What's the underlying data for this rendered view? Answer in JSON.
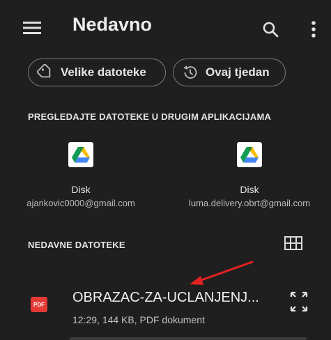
{
  "header": {
    "title": "Nedavno",
    "menu_icon": "hamburger-menu-icon",
    "search_icon": "search-icon",
    "more_icon": "more-vert-icon"
  },
  "filters": [
    {
      "label": "Velike datoteke",
      "icon": "label-tag-icon"
    },
    {
      "label": "Ovaj tjedan",
      "icon": "history-clock-icon"
    }
  ],
  "other_apps": {
    "title": "PREGLEDAJTE DATOTEKE U DRUGIM APLIKACIJAMA",
    "accounts": [
      {
        "name": "Disk",
        "email": "ajankovic0000@gmail.com",
        "icon": "google-drive-icon"
      },
      {
        "name": "Disk",
        "email": "luma.delivery.obrt@gmail.com",
        "icon": "google-drive-icon"
      }
    ]
  },
  "recent": {
    "title": "NEDAVNE DATOTEKE",
    "view_toggle_icon": "grid-view-icon",
    "files": [
      {
        "name": "OBRAZAC-ZA-UCLANJENJ...",
        "meta": "12:29, 144 KB, PDF dokument",
        "type_badge": "PDF",
        "expand_icon": "fullscreen-expand-icon"
      }
    ]
  },
  "colors": {
    "background": "#1f1f1f",
    "annotation_arrow": "#e32222",
    "pdf_badge": "#e53935"
  }
}
